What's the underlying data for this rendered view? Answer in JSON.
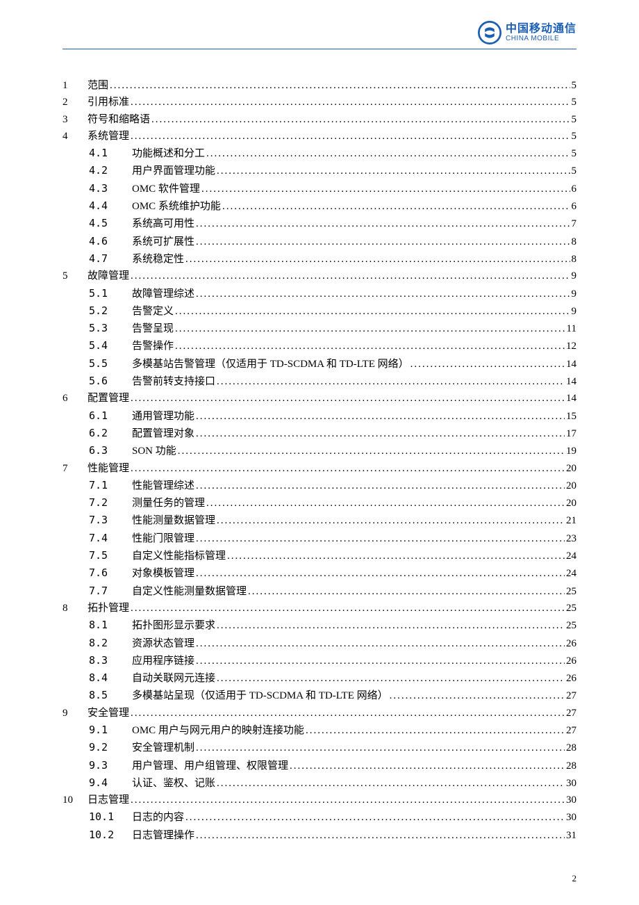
{
  "brand": {
    "cn": "中国移动通信",
    "en": "CHINA MOBILE"
  },
  "page_number": "2",
  "toc": [
    {
      "level": 1,
      "num": "1",
      "title": "范围",
      "page": "5"
    },
    {
      "level": 1,
      "num": "2",
      "title": "引用标准",
      "page": "5"
    },
    {
      "level": 1,
      "num": "3",
      "title": "符号和缩略语",
      "page": "5"
    },
    {
      "level": 1,
      "num": "4",
      "title": "系统管理",
      "page": "5"
    },
    {
      "level": 2,
      "num": "4.1",
      "title": "功能概述和分工",
      "page": "5"
    },
    {
      "level": 2,
      "num": "4.2",
      "title": "用户界面管理功能",
      "page": "5"
    },
    {
      "level": 2,
      "num": "4.3",
      "title": "OMC 软件管理",
      "page": "6"
    },
    {
      "level": 2,
      "num": "4.4",
      "title": "OMC 系统维护功能",
      "page": "6"
    },
    {
      "level": 2,
      "num": "4.5",
      "title": "系统高可用性",
      "page": "7"
    },
    {
      "level": 2,
      "num": "4.6",
      "title": "系统可扩展性",
      "page": "8"
    },
    {
      "level": 2,
      "num": "4.7",
      "title": "系统稳定性",
      "page": "8"
    },
    {
      "level": 1,
      "num": "5",
      "title": "故障管理",
      "page": "9"
    },
    {
      "level": 2,
      "num": "5.1",
      "title": "故障管理综述",
      "page": "9"
    },
    {
      "level": 2,
      "num": "5.2",
      "title": "告警定义",
      "page": "9"
    },
    {
      "level": 2,
      "num": "5.3",
      "title": "告警呈现",
      "page": "11"
    },
    {
      "level": 2,
      "num": "5.4",
      "title": "告警操作",
      "page": "12"
    },
    {
      "level": 2,
      "num": "5.5",
      "title": "多模基站告警管理（仅适用于 TD-SCDMA 和 TD-LTE 网络）",
      "page": "14"
    },
    {
      "level": 2,
      "num": "5.6",
      "title": "告警前转支持接口",
      "page": "14"
    },
    {
      "level": 1,
      "num": "6",
      "title": "配置管理",
      "page": "14"
    },
    {
      "level": 2,
      "num": "6.1",
      "title": "通用管理功能",
      "page": "15"
    },
    {
      "level": 2,
      "num": "6.2",
      "title": "配置管理对象",
      "page": "17"
    },
    {
      "level": 2,
      "num": "6.3",
      "title": "SON 功能",
      "page": "19"
    },
    {
      "level": 1,
      "num": "7",
      "title": "性能管理",
      "page": "20"
    },
    {
      "level": 2,
      "num": "7.1",
      "title": "性能管理综述",
      "page": "20"
    },
    {
      "level": 2,
      "num": "7.2",
      "title": "测量任务的管理",
      "page": "20"
    },
    {
      "level": 2,
      "num": "7.3",
      "title": "性能测量数据管理",
      "page": "21"
    },
    {
      "level": 2,
      "num": "7.4",
      "title": "性能门限管理",
      "page": "23"
    },
    {
      "level": 2,
      "num": "7.5",
      "title": "自定义性能指标管理",
      "page": "24"
    },
    {
      "level": 2,
      "num": "7.6",
      "title": "对象模板管理",
      "page": "24"
    },
    {
      "level": 2,
      "num": "7.7",
      "title": "自定义性能测量数据管理",
      "page": "25"
    },
    {
      "level": 1,
      "num": "8",
      "title": "拓扑管理",
      "page": "25"
    },
    {
      "level": 2,
      "num": "8.1",
      "title": "拓扑图形显示要求",
      "page": "25"
    },
    {
      "level": 2,
      "num": "8.2",
      "title": "资源状态管理",
      "page": "26"
    },
    {
      "level": 2,
      "num": "8.3",
      "title": "应用程序链接",
      "page": "26"
    },
    {
      "level": 2,
      "num": "8.4",
      "title": "自动关联网元连接",
      "page": "26"
    },
    {
      "level": 2,
      "num": "8.5",
      "title": "多模基站呈现（仅适用于 TD-SCDMA 和 TD-LTE 网络）",
      "page": "27"
    },
    {
      "level": 1,
      "num": "9",
      "title": "安全管理",
      "page": "27"
    },
    {
      "level": 2,
      "num": "9.1",
      "title": "OMC 用户与网元用户的映射连接功能",
      "page": "27"
    },
    {
      "level": 2,
      "num": "9.2",
      "title": "安全管理机制",
      "page": "28"
    },
    {
      "level": 2,
      "num": "9.3",
      "title": "用户管理、用户组管理、权限管理",
      "page": "28"
    },
    {
      "level": 2,
      "num": "9.4",
      "title": "认证、鉴权、记账",
      "page": "30"
    },
    {
      "level": 1,
      "num": "10",
      "title": "日志管理",
      "page": "30"
    },
    {
      "level": 2,
      "num": "10.1",
      "title": "日志的内容",
      "page": "30"
    },
    {
      "level": 2,
      "num": "10.2",
      "title": "日志管理操作",
      "page": "31"
    }
  ]
}
